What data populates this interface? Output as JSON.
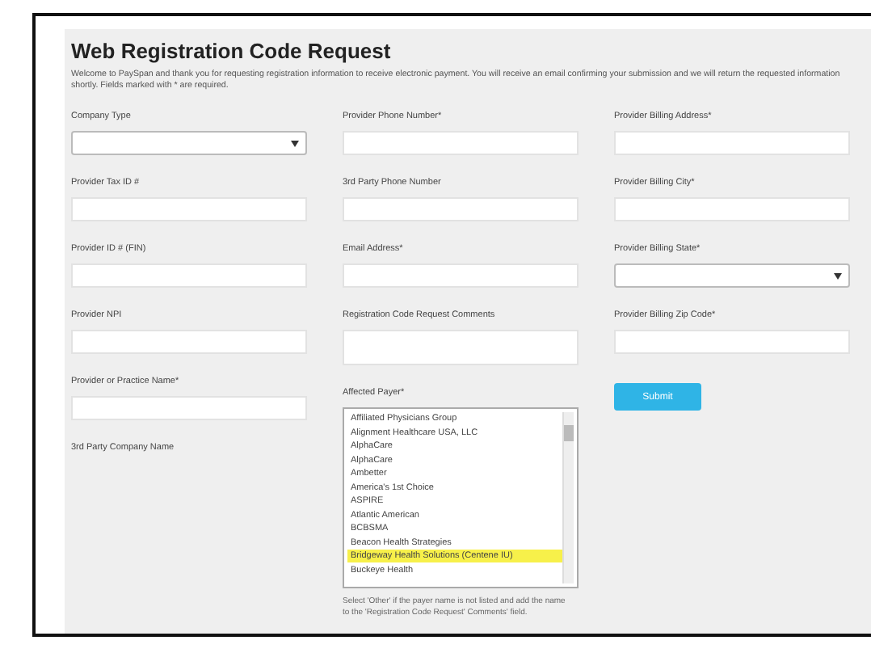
{
  "title": "Web Registration Code Request",
  "intro": "Welcome to PaySpan and thank you for requesting registration information to receive electronic payment. You will receive an email confirming your submission and we will return the requested information shortly. Fields marked with * are required.",
  "columns": [
    [
      {
        "kind": "select",
        "label": "Company Type"
      },
      {
        "kind": "text",
        "label": "Provider Tax ID #"
      },
      {
        "kind": "text",
        "label": "Provider ID # (FIN)"
      },
      {
        "kind": "text",
        "label": "Provider NPI"
      },
      {
        "kind": "text",
        "label": "Provider or Practice Name*"
      },
      {
        "kind": "label",
        "label": "3rd Party Company Name"
      }
    ],
    [
      {
        "kind": "text",
        "label": "Provider Phone Number*"
      },
      {
        "kind": "text",
        "label": "3rd Party Phone Number"
      },
      {
        "kind": "text",
        "label": "Email Address*"
      },
      {
        "kind": "textarea",
        "label": "Registration Code Request Comments"
      },
      {
        "kind": "listbox",
        "label": "Affected Payer*",
        "options": [
          {
            "text": "Affiliated Physicians Group",
            "selected": false
          },
          {
            "text": "Alignment Healthcare USA, LLC",
            "selected": false
          },
          {
            "text": "AlphaCare",
            "selected": false
          },
          {
            "text": "AlphaCare",
            "selected": false
          },
          {
            "text": "Ambetter",
            "selected": false
          },
          {
            "text": "America's 1st Choice",
            "selected": false
          },
          {
            "text": "ASPIRE",
            "selected": false
          },
          {
            "text": "Atlantic American",
            "selected": false
          },
          {
            "text": "BCBSMA",
            "selected": false
          },
          {
            "text": "Beacon Health Strategies",
            "selected": false
          },
          {
            "text": "Bridgeway Health Solutions (Centene IU)",
            "selected": true
          },
          {
            "text": "Buckeye Health",
            "selected": false
          }
        ],
        "hint": "Select 'Other' if the payer name is not listed and add the name to the 'Registration Code Request' Comments' field."
      }
    ],
    [
      {
        "kind": "text",
        "label": "Provider Billing Address*"
      },
      {
        "kind": "text",
        "label": "Provider Billing City*"
      },
      {
        "kind": "select",
        "label": "Provider Billing State*"
      },
      {
        "kind": "text",
        "label": "Provider Billing Zip Code*"
      },
      {
        "kind": "button",
        "label": "Submit"
      }
    ]
  ]
}
